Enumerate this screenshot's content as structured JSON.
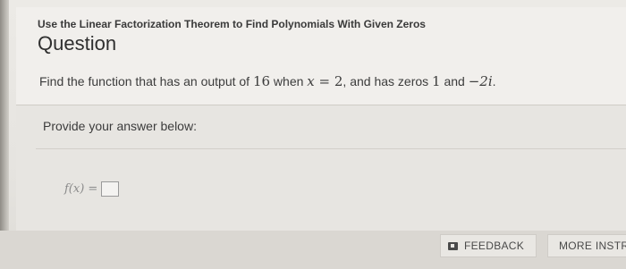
{
  "header": {
    "topic": "Use the Linear Factorization Theorem to Find Polynomials With Given Zeros",
    "heading": "Question"
  },
  "question": {
    "part1": "Find the function that has an output of ",
    "output_value": "16",
    "part2": " when ",
    "variable": "x",
    "equals": " = ",
    "input_value": "2",
    "part3": ", and has zeros ",
    "zero1": "1",
    "part4": " and ",
    "zero2": "−2i",
    "part5": "."
  },
  "answer": {
    "prompt": "Provide your answer below:",
    "function_label": "f(x) ="
  },
  "buttons": {
    "feedback": "FEEDBACK",
    "more_instruction": "MORE INSTR"
  }
}
